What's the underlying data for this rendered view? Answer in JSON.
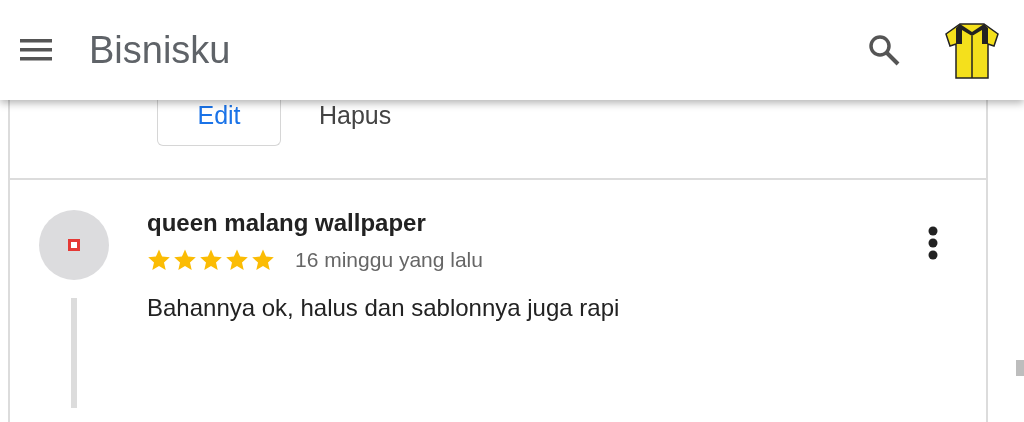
{
  "app_bar": {
    "title": "Bisnisku"
  },
  "actions": [
    {
      "label": "Edit",
      "kind": "outlined"
    },
    {
      "label": "Hapus",
      "kind": "text"
    }
  ],
  "review": {
    "author": "queen malang wallpaper",
    "stars": 5,
    "time": "16 minggu yang lalu",
    "text": "Bahannya ok, halus dan sablonnya juga rapi"
  }
}
